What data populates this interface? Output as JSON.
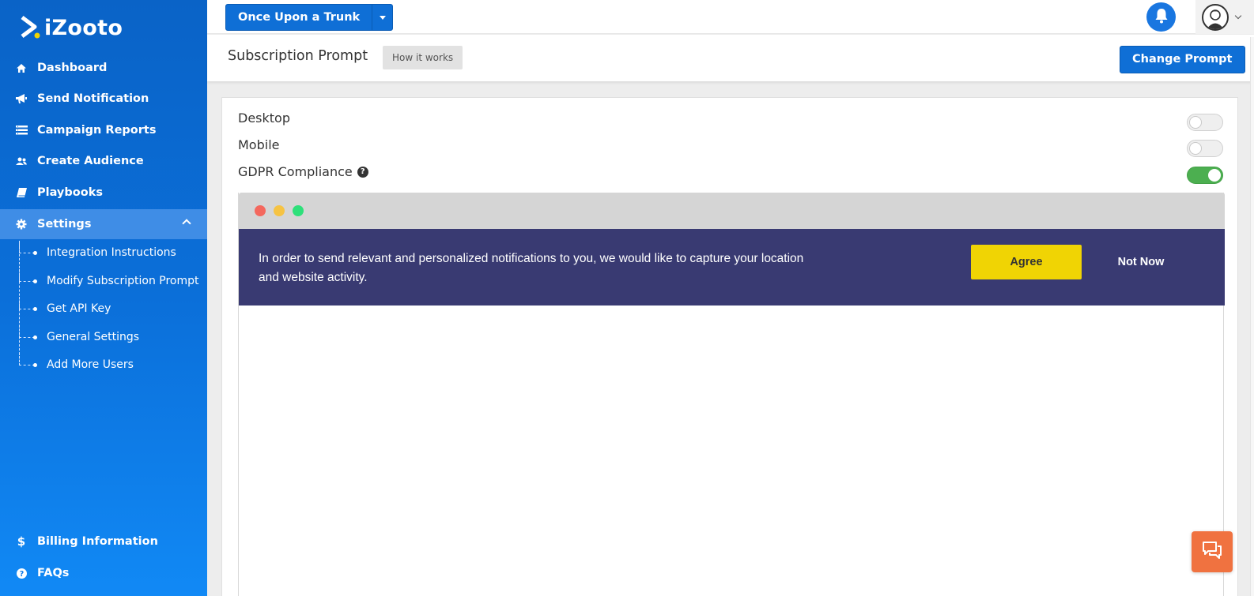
{
  "brand": {
    "name": "iZooto",
    "accent": "#0f6fd6"
  },
  "sidebar": {
    "items": [
      {
        "label": "Dashboard",
        "icon": "home-icon"
      },
      {
        "label": "Send Notification",
        "icon": "megaphone-icon"
      },
      {
        "label": "Campaign Reports",
        "icon": "list-icon"
      },
      {
        "label": "Create Audience",
        "icon": "users-icon"
      },
      {
        "label": "Playbooks",
        "icon": "book-icon"
      },
      {
        "label": "Settings",
        "icon": "gear-icon"
      }
    ],
    "settings_subitems": [
      "Integration Instructions",
      "Modify Subscription Prompt",
      "Get API Key",
      "General Settings",
      "Add More Users"
    ],
    "bottom_items": [
      {
        "label": "Billing Information",
        "icon": "dollar-icon"
      },
      {
        "label": "FAQs",
        "icon": "question-icon"
      }
    ]
  },
  "topbar": {
    "site_name": "Once Upon a Trunk"
  },
  "header": {
    "title": "Subscription Prompt",
    "how_it_works": "How it works",
    "change_prompt": "Change Prompt"
  },
  "settings": {
    "desktop": {
      "label": "Desktop",
      "enabled": false
    },
    "mobile": {
      "label": "Mobile",
      "enabled": false
    },
    "gdpr": {
      "label": "GDPR Compliance",
      "enabled": true
    }
  },
  "preview": {
    "message": "In order to send relevant and personalized notifications to you, we would like to capture your location and website activity.",
    "agree": "Agree",
    "not_now": "Not Now",
    "bar_color": "#393a72",
    "agree_color": "#f0d404"
  }
}
